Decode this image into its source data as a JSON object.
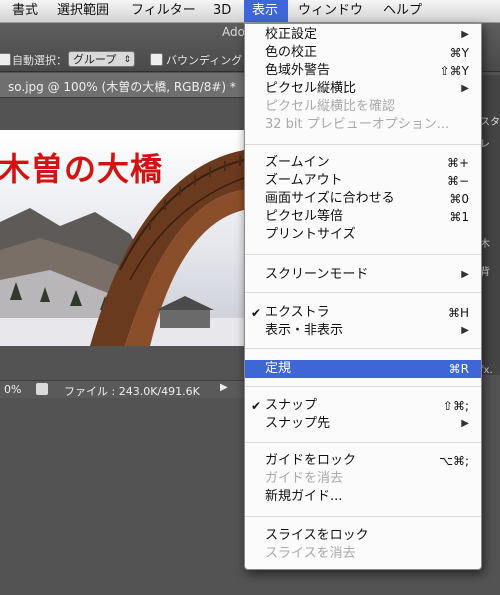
{
  "menubar": {
    "items": [
      "書式",
      "選択範囲",
      "フィルター",
      "3D",
      "表示",
      "ウィンドウ",
      "ヘルプ"
    ],
    "active": "表示"
  },
  "options_bar": {
    "app_title": "Ado",
    "auto_select_label": "自動選択：",
    "group_value": "グループ",
    "bounding_label": "バウンディング"
  },
  "document": {
    "tab_title": "so.jpg @ 100% (木曽の大橋, RGB/8#) *",
    "photo_title": "木曽の大橋"
  },
  "status_bar": {
    "zoom": "0%",
    "file_info": "ファイル : 243.0K/491.6K"
  },
  "right_panel": {
    "labels": [
      "スタ",
      "レ",
      "木",
      "背",
      "fx."
    ]
  },
  "view_menu": {
    "items": [
      {
        "label": "校正設定",
        "shortcut": "",
        "submenu": true,
        "enabled": true
      },
      {
        "label": "色の校正",
        "shortcut": "⌘Y",
        "submenu": false,
        "enabled": true
      },
      {
        "label": "色域外警告",
        "shortcut": "⇧⌘Y",
        "submenu": false,
        "enabled": true
      },
      {
        "label": "ピクセル縦横比",
        "shortcut": "",
        "submenu": true,
        "enabled": true
      },
      {
        "label": "ピクセル縦横比を確認",
        "shortcut": "",
        "submenu": false,
        "enabled": false
      },
      {
        "label": "32 bit プレビューオプション...",
        "shortcut": "",
        "submenu": false,
        "enabled": false
      },
      {
        "label": "ズームイン",
        "shortcut": "⌘+",
        "submenu": false,
        "enabled": true
      },
      {
        "label": "ズームアウト",
        "shortcut": "⌘−",
        "submenu": false,
        "enabled": true
      },
      {
        "label": "画面サイズに合わせる",
        "shortcut": "⌘0",
        "submenu": false,
        "enabled": true
      },
      {
        "label": "ピクセル等倍",
        "shortcut": "⌘1",
        "submenu": false,
        "enabled": true
      },
      {
        "label": "プリントサイズ",
        "shortcut": "",
        "submenu": false,
        "enabled": true
      },
      {
        "label": "スクリーンモード",
        "shortcut": "",
        "submenu": true,
        "enabled": true
      },
      {
        "label": "エクストラ",
        "shortcut": "⌘H",
        "submenu": false,
        "enabled": true,
        "checked": true
      },
      {
        "label": "表示・非表示",
        "shortcut": "",
        "submenu": true,
        "enabled": true
      },
      {
        "label": "定規",
        "shortcut": "⌘R",
        "submenu": false,
        "enabled": true,
        "highlighted": true
      },
      {
        "label": "スナップ",
        "shortcut": "⇧⌘;",
        "submenu": false,
        "enabled": true,
        "checked": true
      },
      {
        "label": "スナップ先",
        "shortcut": "",
        "submenu": true,
        "enabled": true
      },
      {
        "label": "ガイドをロック",
        "shortcut": "⌥⌘;",
        "submenu": false,
        "enabled": true
      },
      {
        "label": "ガイドを消去",
        "shortcut": "",
        "submenu": false,
        "enabled": false
      },
      {
        "label": "新規ガイド...",
        "shortcut": "",
        "submenu": false,
        "enabled": true
      },
      {
        "label": "スライスをロック",
        "shortcut": "",
        "submenu": false,
        "enabled": true
      },
      {
        "label": "スライスを消去",
        "shortcut": "",
        "submenu": false,
        "enabled": false
      }
    ]
  },
  "colors": {
    "menu_highlight": "#3f66d6",
    "photo_title_red": "#d31212"
  }
}
